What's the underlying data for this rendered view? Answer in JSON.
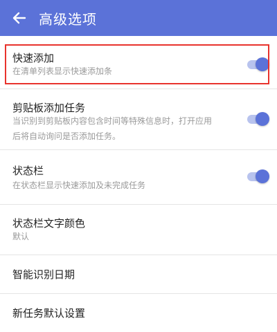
{
  "app_bar": {
    "title": "高级选项",
    "back_icon": "arrow-left-icon",
    "background": "#5b72d8"
  },
  "settings": [
    {
      "title": "快速添加",
      "subtitle": "在清单列表显示快速添加条",
      "toggle": true,
      "highlighted": true
    },
    {
      "title": "剪贴板添加任务",
      "subtitle": "当识别到剪贴板内容包含时间等特殊信息时，打开应用后将自动询问是否添加任务。",
      "toggle": true
    },
    {
      "title": "状态栏",
      "subtitle": "在状态栏显示快速添加及未完成任务",
      "toggle": true
    },
    {
      "title": "状态栏文字颜色",
      "subtitle": "默认"
    },
    {
      "title": "智能识别日期"
    },
    {
      "title": "新任务默认设置"
    }
  ],
  "colors": {
    "accent": "#5b72d8",
    "highlight_border": "#e8322c"
  }
}
